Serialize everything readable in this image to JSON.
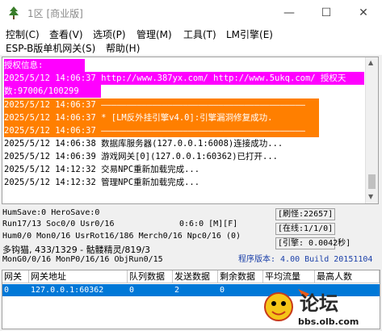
{
  "window": {
    "title": "1区 [商业版]",
    "minimize_glyph": "—",
    "maximize_glyph": "☐",
    "close_glyph": "✕"
  },
  "menu": {
    "row1": [
      "控制(C)",
      "查看(V)",
      "选项(P)",
      "管理(M)",
      "工具(T)",
      "LM引擎(E)"
    ],
    "row2": [
      "ESP-B版单机网关(S)",
      "帮助(H)"
    ]
  },
  "log": {
    "lines": [
      {
        "text": "授权信息:",
        "style": "m"
      },
      {
        "text": "2025/5/12 14:06:37 http://www.387yx.com/ http://www.5ukq.com/ 授权天",
        "style": "m"
      },
      {
        "text": "数:97006/100299",
        "style": "m"
      },
      {
        "text": "2025/5/12 14:06:37 ————————————————————————————————————————",
        "style": "o"
      },
      {
        "text": "2025/5/12 14:06:37 * [LM反外挂引擎v4.0]:引擎漏洞修复成功.",
        "style": "o"
      },
      {
        "text": "2025/5/12 14:06:37 ————————————————————————————————————————",
        "style": "o"
      },
      {
        "text": "2025/5/12 14:06:38 数据库服务器(127.0.0.1:6008)连接成功...",
        "style": ""
      },
      {
        "text": "2025/5/12 14:06:39 游戏网关[0](127.0.0.1:60362)已打开...",
        "style": ""
      },
      {
        "text": "2025/5/12 14:12:32 交易NPC重新加载完成...",
        "style": ""
      },
      {
        "text": "2025/5/12 14:12:32 管理NPC重新加载完成...",
        "style": ""
      }
    ]
  },
  "status": {
    "line1": "HumSave:0 HeroSave:0",
    "line2": "Run17/13 Soc0/0 Usr0/16",
    "line2_mid": "0:6:0 [M][F]",
    "line3": "Hum0/0 Mon0/16 UsrRot16/186 Merch0/16 Npc0/16 (0)",
    "line4": "多钩猫, 433/1329 - 骷髅精灵/819/3",
    "line5": "MonG0/0/16 MonP0/16/16 ObjRun0/15",
    "refresh": "[刷怪:22657]",
    "online": "[在线:1/1/0]",
    "engine": "[引擎: 0.0042秒]",
    "version": "程序版本: 4.00 Build 20151104"
  },
  "table": {
    "headers": [
      "网关",
      "网关地址",
      "队列数据",
      "发送数据",
      "剩余数据",
      "平均流量",
      "最高人数"
    ],
    "rows": [
      [
        "0",
        "127.0.0.1:60362",
        "0",
        "2",
        "0",
        "",
        ""
      ]
    ]
  },
  "watermark": {
    "logo_text": "论坛",
    "site_text": "bbs.olb.com"
  },
  "colors": {
    "highlight_magenta": "#ff00ff",
    "highlight_orange": "#ff7f00",
    "selection_blue": "#0078d7",
    "version_blue": "#1a3fa8"
  }
}
